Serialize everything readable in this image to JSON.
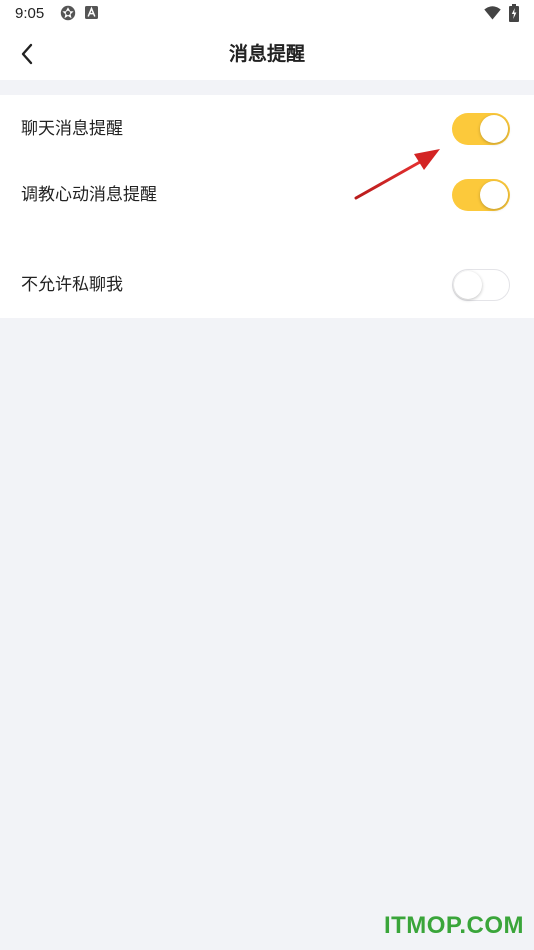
{
  "status_bar": {
    "time": "9:05",
    "icons": [
      "aperture-icon",
      "a-box-icon",
      "wifi-icon",
      "battery-charging-icon"
    ]
  },
  "header": {
    "back_icon": "chevron-left-icon",
    "title": "消息提醒"
  },
  "settings": [
    {
      "label": "聊天消息提醒",
      "enabled": true
    },
    {
      "label": "调教心动消息提醒",
      "enabled": true
    },
    {
      "label": "不允许私聊我",
      "enabled": false
    }
  ],
  "colors": {
    "accent": "#fcc93b",
    "background": "#f2f3f7",
    "card": "#ffffff",
    "annotation": "#d32424",
    "watermark": "#3aa53a"
  },
  "watermark": "ITMOP.COM"
}
